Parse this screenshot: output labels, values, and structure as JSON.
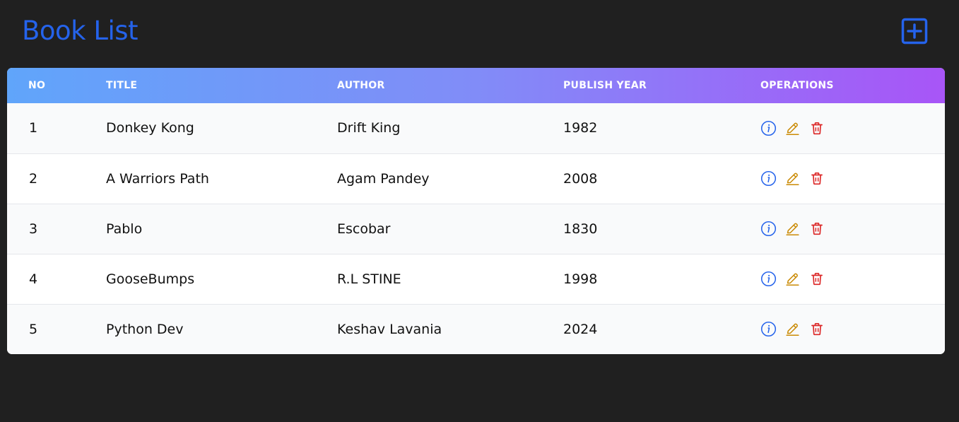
{
  "header": {
    "title": "Book List",
    "add_icon": "plus-square-icon"
  },
  "colors": {
    "title": "#2563eb",
    "header_gradient_start": "#60a5fa",
    "header_gradient_end": "#a855f7",
    "info": "#2563eb",
    "edit": "#ca8a04",
    "delete": "#dc2626"
  },
  "table": {
    "columns": [
      "NO",
      "TITLE",
      "AUTHOR",
      "PUBLISH YEAR",
      "OPERATIONS"
    ],
    "rows": [
      {
        "no": "1",
        "title": "Donkey Kong",
        "author": "Drift King",
        "year": "1982"
      },
      {
        "no": "2",
        "title": "A Warriors Path",
        "author": "Agam Pandey",
        "year": "2008"
      },
      {
        "no": "3",
        "title": "Pablo",
        "author": "Escobar",
        "year": "1830"
      },
      {
        "no": "4",
        "title": "GooseBumps",
        "author": "R.L STINE",
        "year": "1998"
      },
      {
        "no": "5",
        "title": "Python Dev",
        "author": "Keshav Lavania",
        "year": "2024"
      }
    ],
    "operation_icons": [
      "info-circle-icon",
      "pencil-icon",
      "trash-icon"
    ]
  }
}
